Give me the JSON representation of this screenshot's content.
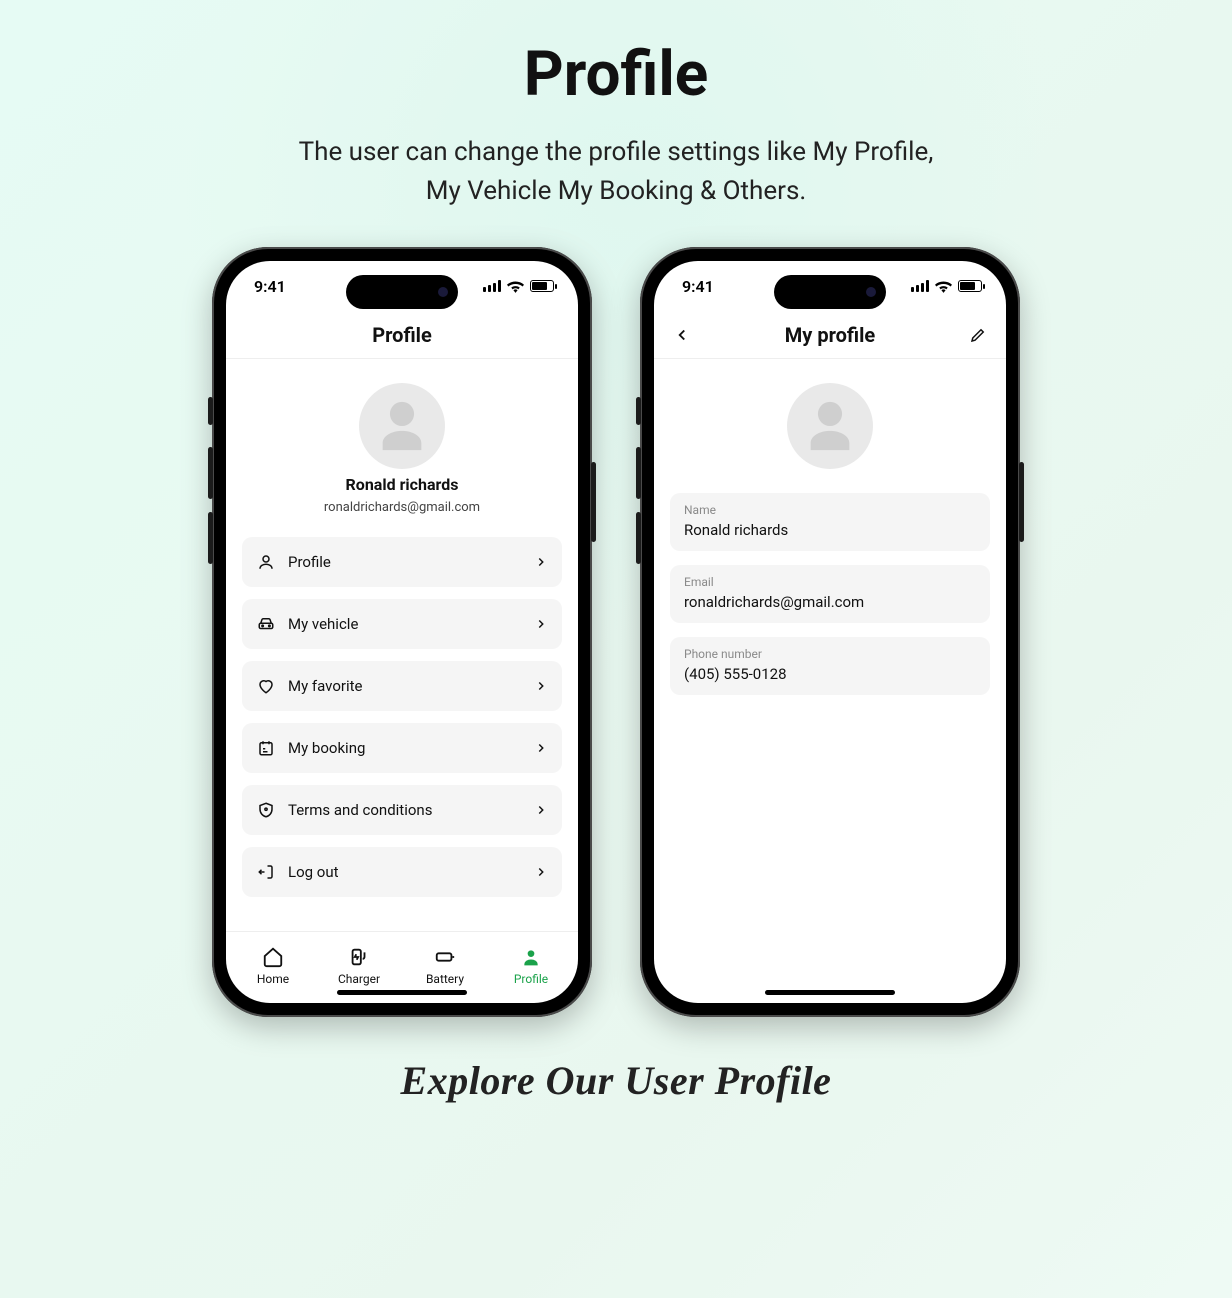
{
  "page": {
    "title": "Profile",
    "subtitle_line1": "The user can change the profile settings like My Profile,",
    "subtitle_line2": "My Vehicle My Booking & Others.",
    "footer": "Explore Our User Profile"
  },
  "status": {
    "time": "9:41"
  },
  "accent": "#1aa24a",
  "phone1": {
    "header": {
      "title": "Profile"
    },
    "user": {
      "name": "Ronald richards",
      "email": "ronaldrichards@gmail.com"
    },
    "menu": [
      {
        "id": "profile",
        "label": "Profile",
        "icon": "user-icon"
      },
      {
        "id": "vehicle",
        "label": "My vehicle",
        "icon": "car-icon"
      },
      {
        "id": "favorite",
        "label": "My favorite",
        "icon": "heart-icon"
      },
      {
        "id": "booking",
        "label": "My booking",
        "icon": "calendar-icon"
      },
      {
        "id": "terms",
        "label": "Terms and conditions",
        "icon": "shield-icon"
      },
      {
        "id": "logout",
        "label": "Log out",
        "icon": "logout-icon"
      }
    ],
    "tabs": [
      {
        "id": "home",
        "label": "Home",
        "icon": "home-icon",
        "active": false
      },
      {
        "id": "charger",
        "label": "Charger",
        "icon": "charger-icon",
        "active": false
      },
      {
        "id": "battery",
        "label": "Battery",
        "icon": "battery-icon",
        "active": false
      },
      {
        "id": "profile",
        "label": "Profile",
        "icon": "person-icon",
        "active": true
      }
    ]
  },
  "phone2": {
    "header": {
      "title": "My profile"
    },
    "fields": {
      "name": {
        "label": "Name",
        "value": "Ronald richards"
      },
      "email": {
        "label": "Email",
        "value": "ronaldrichards@gmail.com"
      },
      "phone": {
        "label": "Phone number",
        "value": "(405) 555-0128"
      }
    }
  }
}
